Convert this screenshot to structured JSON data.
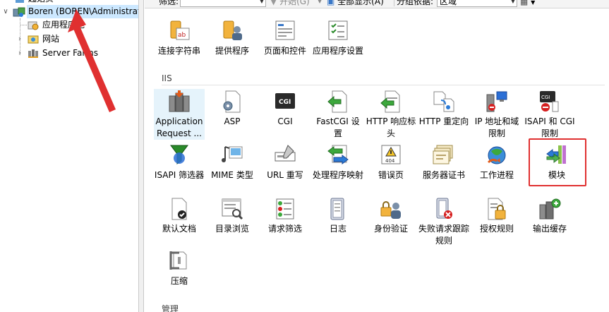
{
  "tree": {
    "root_partial": "起始页",
    "server": "Boren (BOREN\\Administrat",
    "items": [
      {
        "label": "应用程序池",
        "icon": "app-pool-icon"
      },
      {
        "label": "网站",
        "icon": "sites-icon"
      },
      {
        "label": "Server Farms",
        "icon": "server-farms-icon"
      }
    ]
  },
  "toolbar": {
    "filter_label": "筛选:",
    "filter_value": "",
    "start_label": "开始(G)",
    "show_all_label": "全部显示(A)",
    "group_by_label": "分组依据:",
    "group_by_value": "区域"
  },
  "groups": {
    "iis_title": "IIS",
    "manage_title": "管理"
  },
  "top_features": [
    {
      "label": "连接字符串",
      "icon": "connection-strings-icon"
    },
    {
      "label": "提供程序",
      "icon": "providers-icon"
    },
    {
      "label": "页面和控件",
      "icon": "pages-controls-icon"
    },
    {
      "label": "应用程序设置",
      "icon": "app-settings-icon"
    }
  ],
  "iis_features": [
    {
      "label": "Application Request ...",
      "icon": "application-request-routing-icon"
    },
    {
      "label": "ASP",
      "icon": "asp-icon"
    },
    {
      "label": "CGI",
      "icon": "cgi-icon"
    },
    {
      "label": "FastCGI 设置",
      "icon": "fastcgi-icon"
    },
    {
      "label": "HTTP 响应标头",
      "icon": "http-response-headers-icon"
    },
    {
      "label": "HTTP 重定向",
      "icon": "http-redirect-icon"
    },
    {
      "label": "IP 地址和域限制",
      "icon": "ip-restrictions-icon"
    },
    {
      "label": "ISAPI 和 CGI 限制",
      "icon": "isapi-cgi-restrictions-icon"
    },
    {
      "label": "ISAPI 筛选器",
      "icon": "isapi-filters-icon"
    },
    {
      "label": "MIME 类型",
      "icon": "mime-types-icon"
    },
    {
      "label": "URL 重写",
      "icon": "url-rewrite-icon"
    },
    {
      "label": "处理程序映射",
      "icon": "handler-mappings-icon"
    },
    {
      "label": "错误页",
      "icon": "error-pages-icon"
    },
    {
      "label": "服务器证书",
      "icon": "server-certificates-icon"
    },
    {
      "label": "工作进程",
      "icon": "worker-processes-icon"
    },
    {
      "label": "模块",
      "icon": "modules-icon"
    },
    {
      "label": "默认文档",
      "icon": "default-document-icon"
    },
    {
      "label": "目录浏览",
      "icon": "directory-browsing-icon"
    },
    {
      "label": "请求筛选",
      "icon": "request-filtering-icon"
    },
    {
      "label": "日志",
      "icon": "logging-icon"
    },
    {
      "label": "身份验证",
      "icon": "authentication-icon"
    },
    {
      "label": "失败请求跟踪规则",
      "icon": "failed-request-tracing-icon"
    },
    {
      "label": "授权规则",
      "icon": "authorization-rules-icon"
    },
    {
      "label": "输出缓存",
      "icon": "output-caching-icon"
    },
    {
      "label": "压缩",
      "icon": "compression-icon"
    }
  ],
  "colors": {
    "highlight": "#e03030",
    "selection": "#cce8ff"
  }
}
